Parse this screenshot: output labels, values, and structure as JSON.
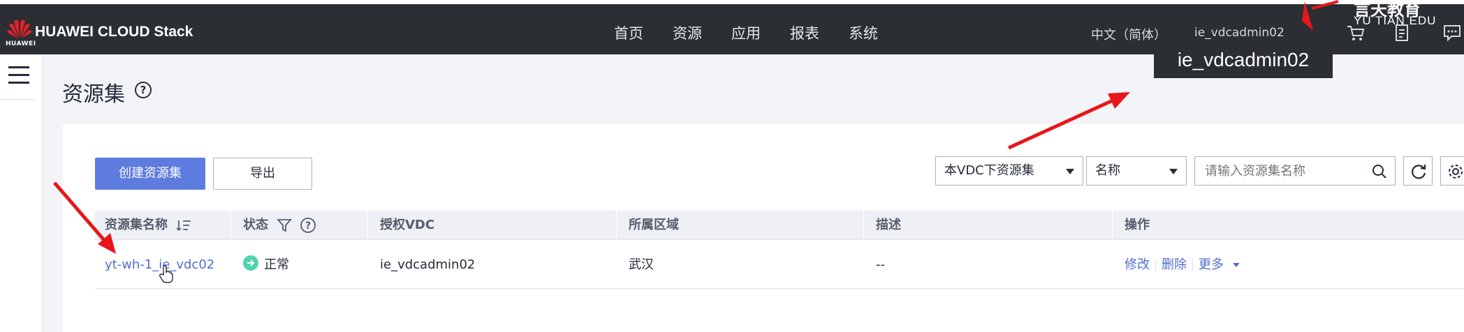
{
  "header": {
    "logo_text": "HUAWEI",
    "brand": "HUAWEI CLOUD Stack",
    "nav": [
      "首页",
      "资源",
      "应用",
      "报表",
      "系统"
    ],
    "language": "中文（简体）",
    "username": "ie_vdcadmin02",
    "tooltip": "ie_vdcadmin02",
    "watermark": "YU TIAN EDU",
    "watermark_top": "言天教育"
  },
  "page": {
    "title": "资源集"
  },
  "toolbar": {
    "create_label": "创建资源集",
    "export_label": "导出",
    "scope_select": "本VDC下资源集",
    "field_select": "名称",
    "search_placeholder": "请输入资源集名称"
  },
  "table": {
    "headers": [
      "资源集名称",
      "状态",
      "授权VDC",
      "所属区域",
      "描述",
      "操作"
    ],
    "rows": [
      {
        "name": "yt-wh-1_ie_vdc02",
        "status": "正常",
        "vdc": "ie_vdcadmin02",
        "region": "武汉",
        "desc": "--",
        "op_edit": "修改",
        "op_delete": "删除",
        "op_more": "更多"
      }
    ]
  },
  "colors": {
    "topbar": "#2b2e33",
    "primary": "#5e7ce0",
    "link": "#526ecc",
    "status_ok": "#50d4ab",
    "annotation_arrow": "#e8161b"
  }
}
